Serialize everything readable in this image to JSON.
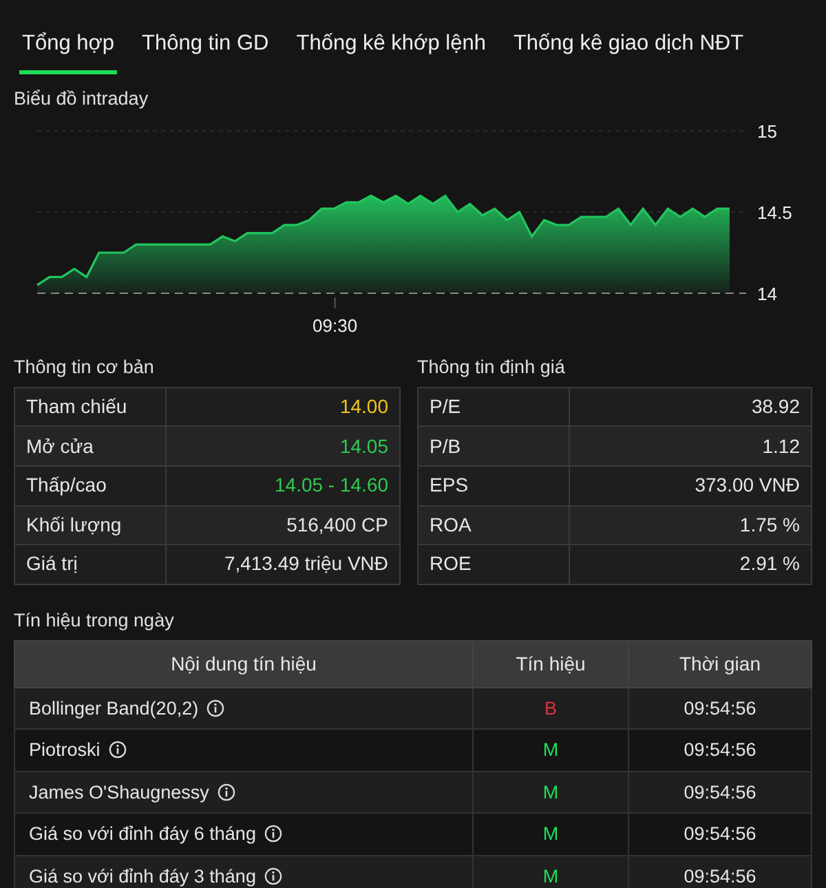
{
  "tabs": [
    {
      "label": "Tổng hợp",
      "selected": true
    },
    {
      "label": "Thông tin GD",
      "selected": false
    },
    {
      "label": "Thống kê khớp lệnh",
      "selected": false
    },
    {
      "label": "Thống kê giao dịch NĐT",
      "selected": false
    }
  ],
  "intraday": {
    "title": "Biểu đồ intraday",
    "chart_data": {
      "type": "area",
      "series": [
        {
          "color": "#22c55e",
          "values": [
            14.05,
            14.1,
            14.1,
            14.15,
            14.1,
            14.25,
            14.25,
            14.25,
            14.3,
            14.3,
            14.3,
            14.3,
            14.3,
            14.3,
            14.3,
            14.35,
            14.32,
            14.37,
            14.37,
            14.37,
            14.42,
            14.42,
            14.45,
            14.52,
            14.52,
            14.56,
            14.56,
            14.6,
            14.56,
            14.6,
            14.55,
            14.6,
            14.55,
            14.6,
            14.5,
            14.55,
            14.48,
            14.52,
            14.45,
            14.5,
            14.35,
            14.45,
            14.42,
            14.42,
            14.47,
            14.47,
            14.47,
            14.52,
            14.42,
            14.52,
            14.42,
            14.52,
            14.47,
            14.52,
            14.47,
            14.52,
            14.52
          ]
        }
      ],
      "ylim": [
        14,
        15
      ],
      "yticks": [
        {
          "value": 15,
          "label": "15"
        },
        {
          "value": 14.5,
          "label": "14.5"
        },
        {
          "value": 14,
          "label": "14"
        }
      ],
      "annotations": [
        {
          "text": "09:30"
        }
      ]
    }
  },
  "basic_info": {
    "title": "Thông tin cơ bản",
    "rows": [
      {
        "label": "Tham chiếu",
        "value": "14.00",
        "color": "#f5c518"
      },
      {
        "label": "Mở cửa",
        "value": "14.05",
        "color": "#2ecc51"
      },
      {
        "label": "Thấp/cao",
        "value": "14.05 - 14.60",
        "color": "#2ecc51"
      },
      {
        "label": "Khối lượng",
        "value": "516,400 CP",
        "color": "#e6e6e6"
      },
      {
        "label": "Giá trị",
        "value": "7,413.49 triệu VNĐ",
        "color": "#e6e6e6"
      }
    ]
  },
  "valuation": {
    "title": "Thông tin định giá",
    "rows": [
      {
        "label": "P/E",
        "value": "38.92"
      },
      {
        "label": "P/B",
        "value": "1.12"
      },
      {
        "label": "EPS",
        "value": "373.00 VNĐ"
      },
      {
        "label": "ROA",
        "value": "1.75 %"
      },
      {
        "label": "ROE",
        "value": "2.91 %"
      }
    ]
  },
  "signals": {
    "title": "Tín hiệu trong ngày",
    "columns": [
      "Nội dung tín hiệu",
      "Tín hiệu",
      "Thời gian"
    ],
    "rows": [
      {
        "name": "Bollinger Band(20,2)",
        "signal": "B",
        "color": "#e0303a",
        "time": "09:54:56"
      },
      {
        "name": "Piotroski",
        "signal": "M",
        "color": "#1ee05a",
        "time": "09:54:56"
      },
      {
        "name": "James O'Shaugnessy",
        "signal": "M",
        "color": "#1ee05a",
        "time": "09:54:56"
      },
      {
        "name": "Giá so với đỉnh đáy 6 tháng",
        "signal": "M",
        "color": "#1ee05a",
        "time": "09:54:56"
      },
      {
        "name": "Giá so với đỉnh đáy 3 tháng",
        "signal": "M",
        "color": "#1ee05a",
        "time": "09:54:56"
      }
    ]
  }
}
